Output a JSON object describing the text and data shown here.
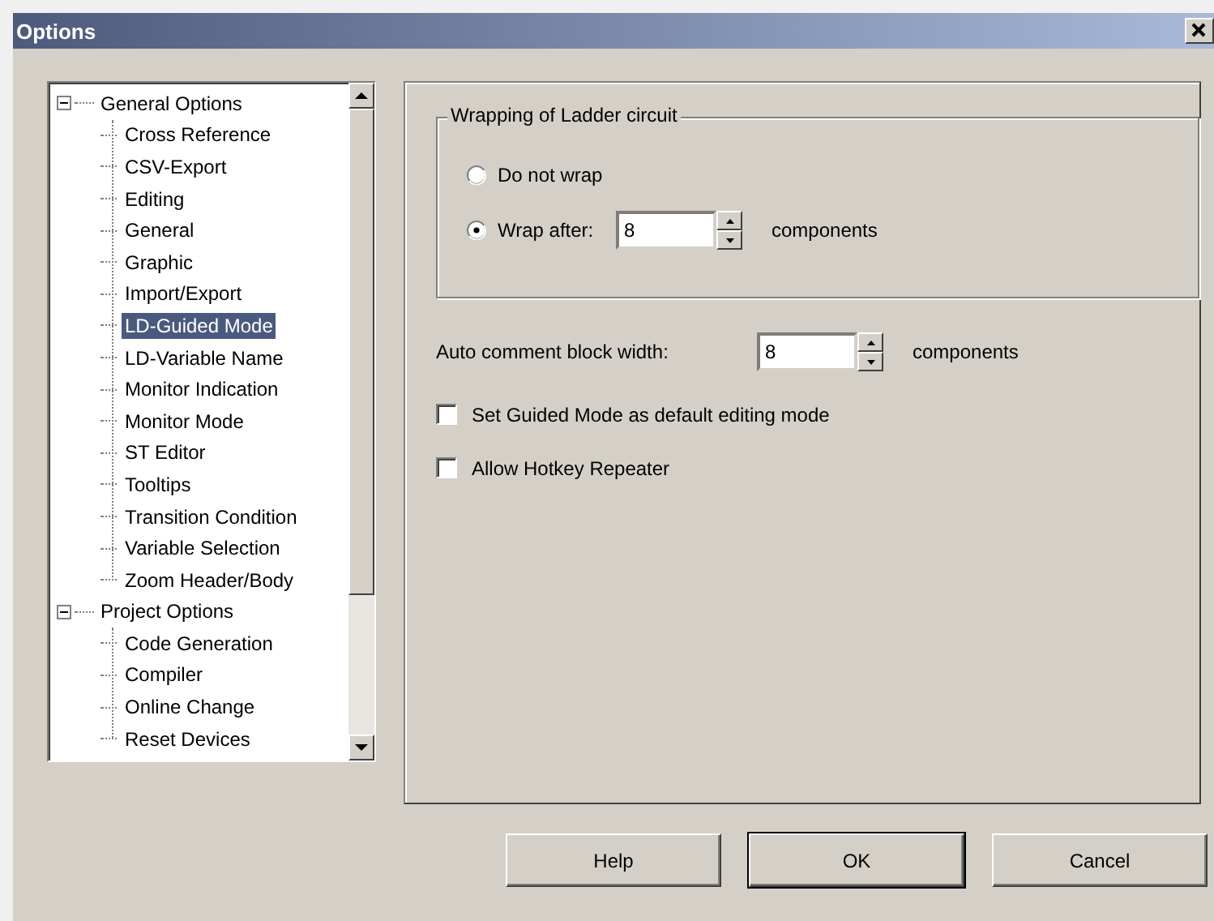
{
  "window": {
    "title": "Options"
  },
  "tree": [
    {
      "label": "General Options",
      "expanded": true,
      "selected": false,
      "children": [
        {
          "label": "Cross Reference",
          "selected": false
        },
        {
          "label": "CSV-Export",
          "selected": false
        },
        {
          "label": "Editing",
          "selected": false
        },
        {
          "label": "General",
          "selected": false
        },
        {
          "label": "Graphic",
          "selected": false
        },
        {
          "label": "Import/Export",
          "selected": false
        },
        {
          "label": "LD-Guided Mode",
          "selected": true
        },
        {
          "label": "LD-Variable Name",
          "selected": false
        },
        {
          "label": "Monitor Indication",
          "selected": false
        },
        {
          "label": "Monitor Mode",
          "selected": false
        },
        {
          "label": "ST Editor",
          "selected": false
        },
        {
          "label": "Tooltips",
          "selected": false
        },
        {
          "label": "Transition Condition",
          "selected": false
        },
        {
          "label": "Variable Selection",
          "selected": false
        },
        {
          "label": "Zoom Header/Body",
          "selected": false
        }
      ]
    },
    {
      "label": "Project Options",
      "expanded": true,
      "selected": false,
      "children": [
        {
          "label": "Code Generation",
          "selected": false
        },
        {
          "label": "Compiler",
          "selected": false
        },
        {
          "label": "Online Change",
          "selected": false
        },
        {
          "label": "Reset Devices",
          "selected": false
        }
      ]
    }
  ],
  "wrapping": {
    "title": "Wrapping of Ladder circuit",
    "options": [
      {
        "label": "Do not wrap",
        "selected": false
      },
      {
        "label": "Wrap after:",
        "selected": true,
        "value": "8",
        "unit": "components"
      }
    ]
  },
  "auto_comment": {
    "label": "Auto comment block width:",
    "value": "8",
    "unit": "components"
  },
  "checkboxes": [
    {
      "label": "Set Guided Mode as default editing mode",
      "checked": false
    },
    {
      "label": "Allow Hotkey Repeater",
      "checked": false
    }
  ],
  "buttons": [
    {
      "label": "Help",
      "default": false
    },
    {
      "label": "OK",
      "default": true
    },
    {
      "label": "Cancel",
      "default": false
    }
  ]
}
